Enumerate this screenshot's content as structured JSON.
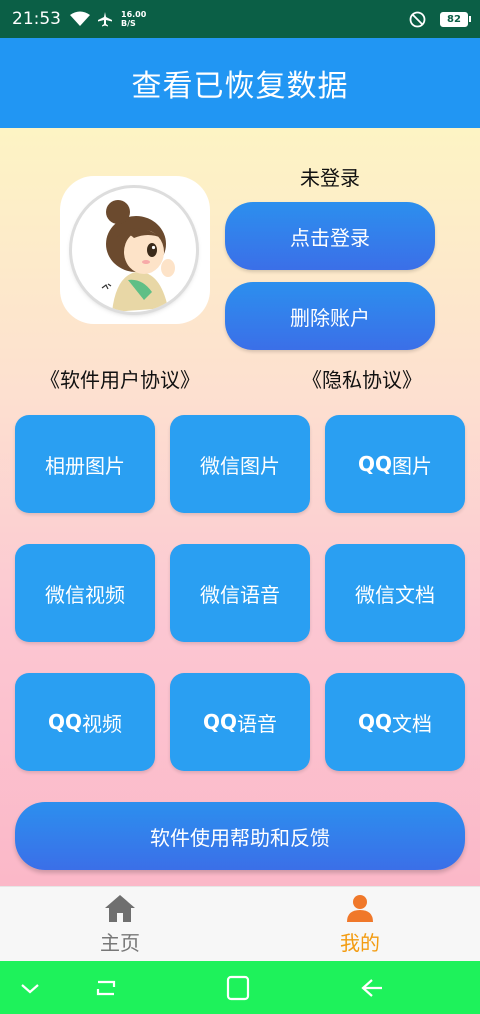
{
  "status_bar": {
    "time": "21:53",
    "speed_value": "16.00",
    "speed_unit": "B/S",
    "battery": "82",
    "icons": [
      "wifi-icon",
      "airplane-icon",
      "dnd-icon"
    ]
  },
  "header": {
    "title": "查看已恢复数据"
  },
  "profile": {
    "login_status": "未登录",
    "login_button": "点击登录",
    "delete_button": "删除账户",
    "avatar_icon": "cartoon-girl-avatar"
  },
  "links": {
    "user_agreement": "《软件用户协议》",
    "privacy_policy": "《隐私协议》"
  },
  "grid": {
    "row1": [
      {
        "prefix": "",
        "label": "相册图片"
      },
      {
        "prefix": "",
        "label": "微信图片"
      },
      {
        "prefix": "QQ",
        "label": "图片"
      }
    ],
    "row2": [
      {
        "prefix": "",
        "label": "微信视频"
      },
      {
        "prefix": "",
        "label": "微信语音"
      },
      {
        "prefix": "",
        "label": "微信文档"
      }
    ],
    "row3": [
      {
        "prefix": "QQ",
        "label": "视频"
      },
      {
        "prefix": "QQ",
        "label": "语音"
      },
      {
        "prefix": "QQ",
        "label": "文档"
      }
    ]
  },
  "help_button": "软件使用帮助和反馈",
  "tabs": [
    {
      "label": "主页",
      "icon": "home-icon",
      "color": "#777777"
    },
    {
      "label": "我的",
      "icon": "person-icon",
      "color": "#f39c12"
    }
  ],
  "colors": {
    "primary": "#2196f3",
    "active_tab": "#f39c12",
    "nav_bar": "#1ef25b"
  }
}
